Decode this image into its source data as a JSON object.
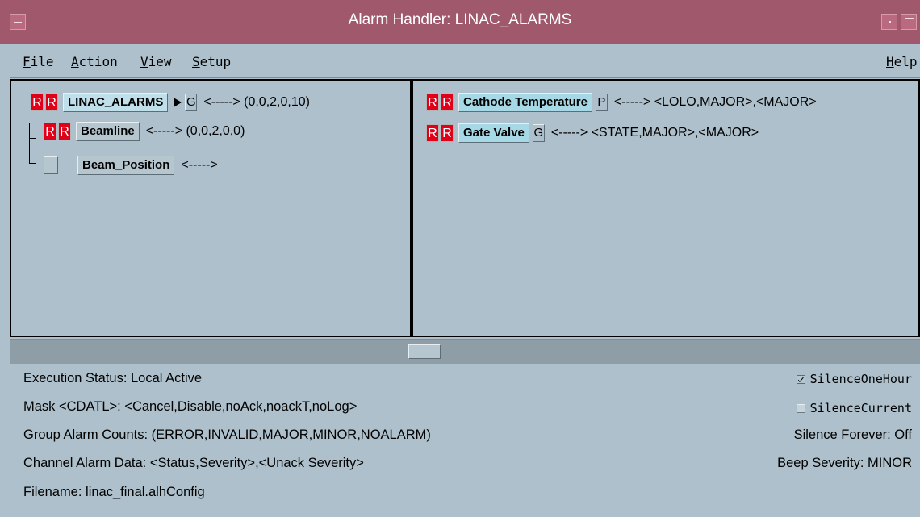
{
  "window": {
    "title": "Alarm Handler: LINAC_ALARMS"
  },
  "menu": {
    "file": "File",
    "action": "Action",
    "view": "View",
    "setup": "Setup",
    "help": "Help"
  },
  "tree": {
    "root": {
      "r1": "R",
      "r2": "R",
      "name": "LINAC_ALARMS",
      "flag": "G",
      "tail": "<-----> (0,0,2,0,10)"
    },
    "child1": {
      "r1": "R",
      "r2": "R",
      "name": "Beamline",
      "tail": "<-----> (0,0,2,0,0)"
    },
    "child2": {
      "name": "Beam_Position",
      "tail": "<----->"
    }
  },
  "channels": [
    {
      "r1": "R",
      "r2": "R",
      "name": "Cathode Temperature",
      "flag": "P",
      "tail": "<-----> <LOLO,MAJOR>,<MAJOR>"
    },
    {
      "r1": "R",
      "r2": "R",
      "name": "Gate Valve",
      "flag": "G",
      "tail": "<-----> <STATE,MAJOR>,<MAJOR>"
    }
  ],
  "status": {
    "execution": "Execution Status:  Local Active",
    "mask": "Mask <CDATL>:  <Cancel,Disable,noAck,noackT,noLog>",
    "group_counts": "Group Alarm Counts:  (ERROR,INVALID,MAJOR,MINOR,NOALARM)",
    "channel_data": "Channel Alarm Data:  <Status,Severity>,<Unack Severity>",
    "filename": "Filename:   linac_final.alhConfig",
    "silence_one_hour": "SilenceOneHour",
    "silence_one_hour_checked": true,
    "silence_current": "SilenceCurrent",
    "silence_current_checked": false,
    "silence_forever": "Silence Forever:  Off",
    "beep_severity": "Beep Severity:  MINOR"
  }
}
